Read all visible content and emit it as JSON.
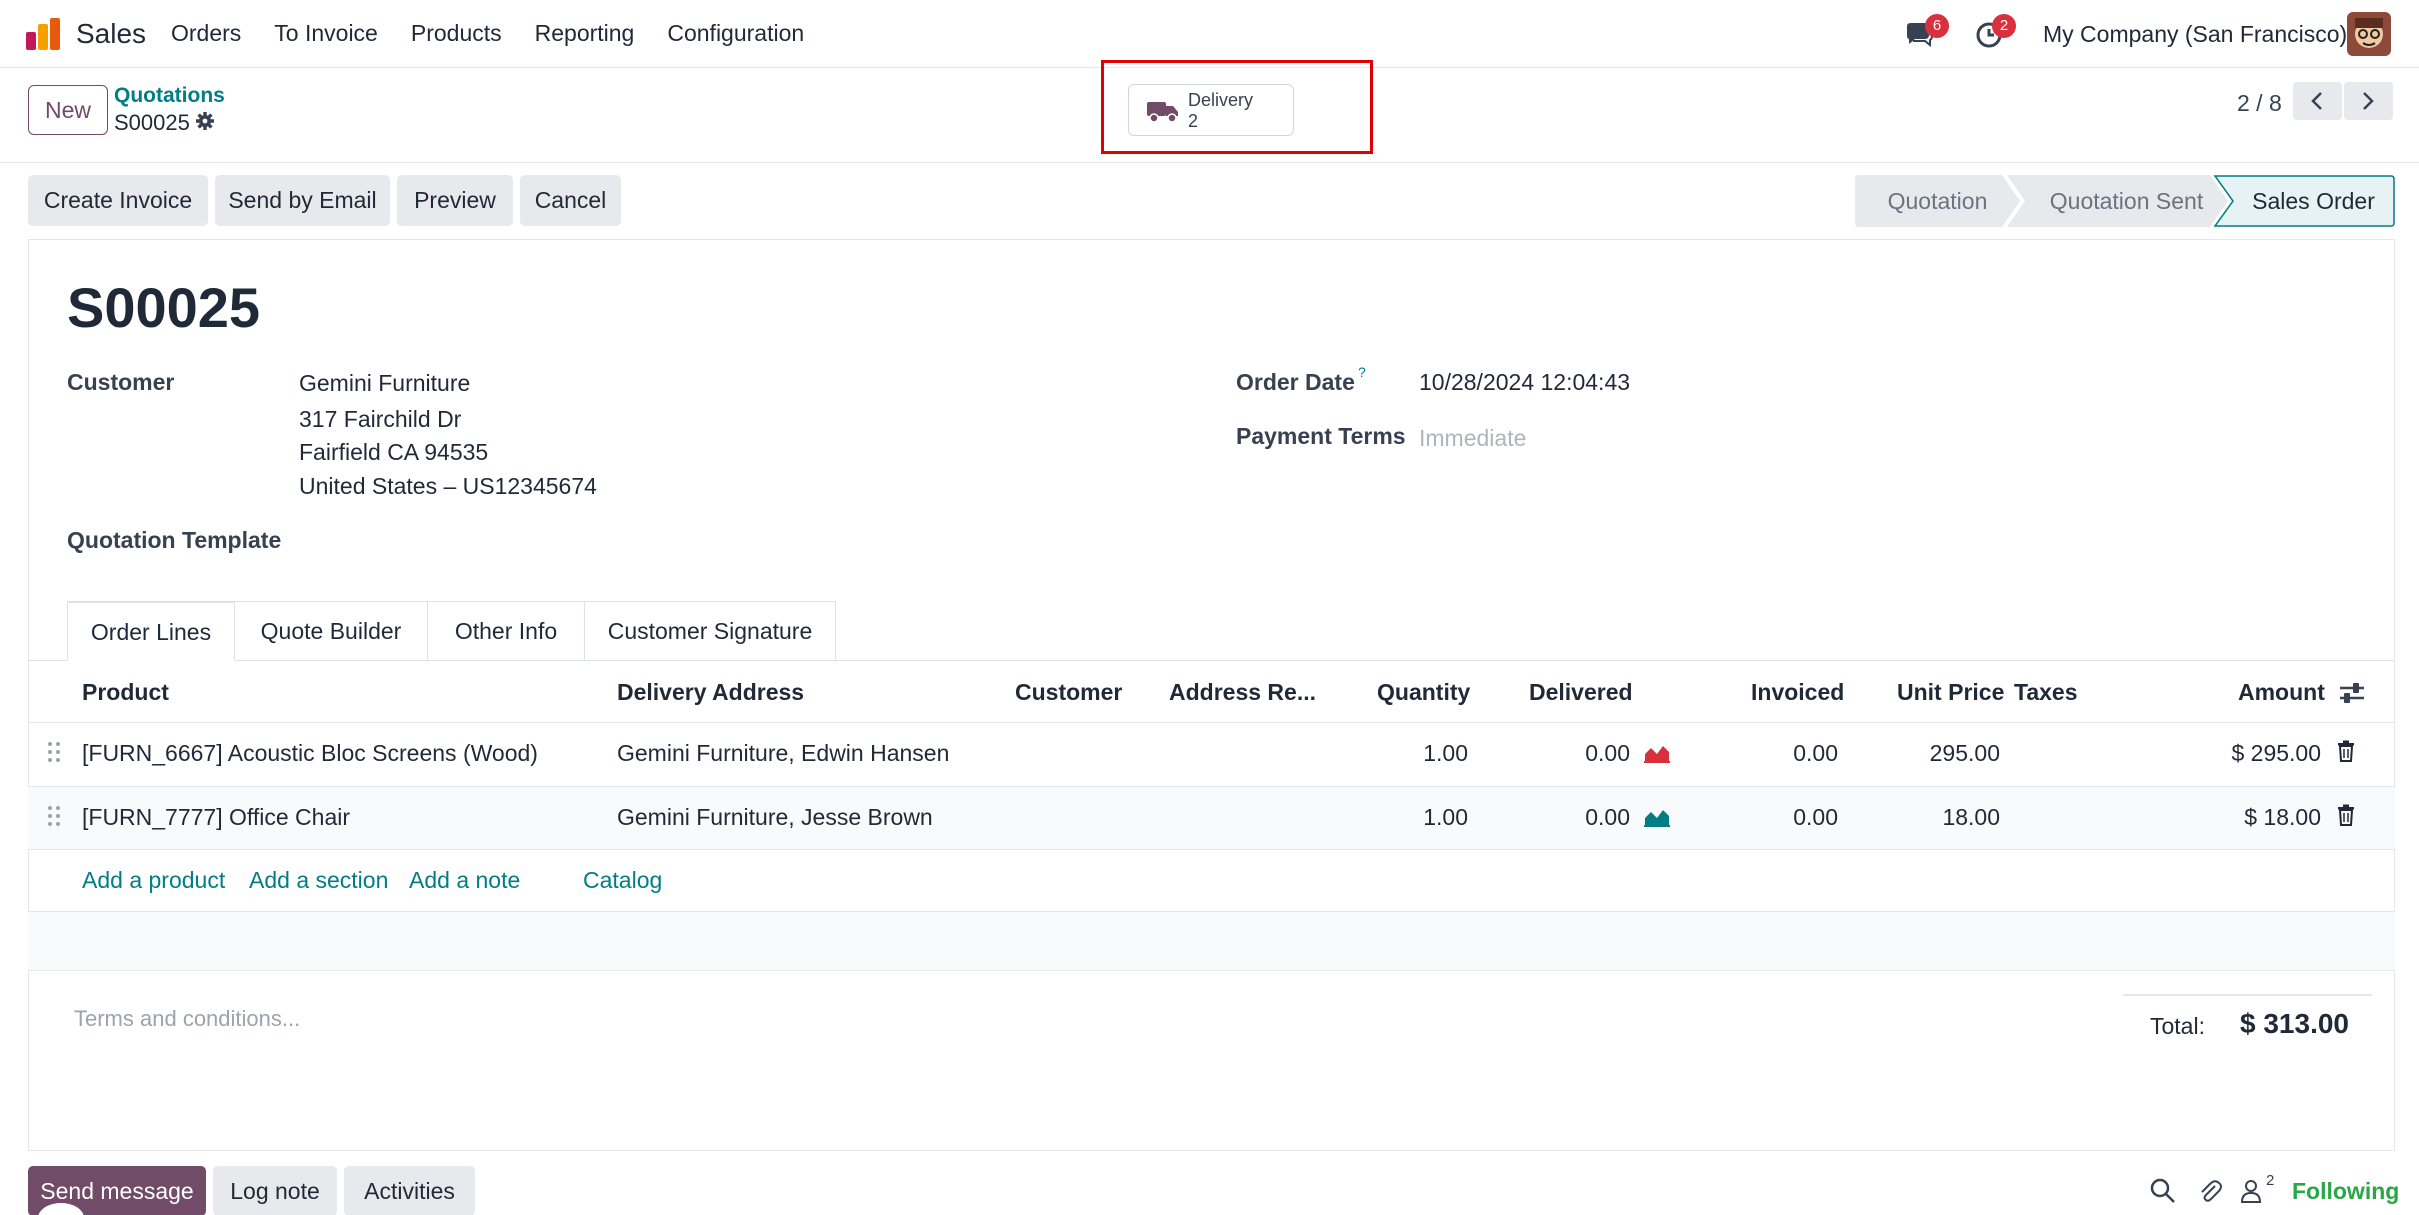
{
  "navbar": {
    "app_name": "Sales",
    "menu": [
      "Orders",
      "To Invoice",
      "Products",
      "Reporting",
      "Configuration"
    ],
    "messages_count": "6",
    "activities_count": "2",
    "company": "My Company (San Francisco)"
  },
  "control_panel": {
    "new_label": "New",
    "breadcrumb_parent": "Quotations",
    "breadcrumb_current": "S00025",
    "smart_button": {
      "label": "Delivery",
      "value": "2"
    },
    "pager": "2 / 8"
  },
  "actions": [
    "Create Invoice",
    "Send by Email",
    "Preview",
    "Cancel"
  ],
  "stages": [
    "Quotation",
    "Quotation Sent",
    "Sales Order"
  ],
  "active_stage": "Sales Order",
  "form": {
    "name": "S00025",
    "customer_label": "Customer",
    "customer_name": "Gemini Furniture",
    "customer_address": [
      "317 Fairchild Dr",
      "Fairfield CA 94535",
      "United States – US12345674"
    ],
    "template_label": "Quotation Template",
    "order_date_label": "Order Date",
    "order_date_help": "?",
    "order_date": "10/28/2024 12:04:43",
    "payment_terms_label": "Payment Terms",
    "payment_terms_placeholder": "Immediate"
  },
  "tabs": [
    "Order Lines",
    "Quote Builder",
    "Other Info",
    "Customer Signature"
  ],
  "table": {
    "columns": [
      "Product",
      "Delivery Address",
      "Customer",
      "Address Re...",
      "Quantity",
      "Delivered",
      "Invoiced",
      "Unit Price",
      "Taxes",
      "Amount"
    ],
    "rows": [
      {
        "product": "[FURN_6667] Acoustic Bloc Screens (Wood)",
        "delivery_address": "Gemini Furniture, Edwin Hansen",
        "quantity": "1.00",
        "delivered": "0.00",
        "invoiced": "0.00",
        "unit_price": "295.00",
        "amount": "$ 295.00",
        "forecast_color": "#d9303e"
      },
      {
        "product": "[FURN_7777] Office Chair",
        "delivery_address": "Gemini Furniture, Jesse Brown",
        "quantity": "1.00",
        "delivered": "0.00",
        "invoiced": "0.00",
        "unit_price": "18.00",
        "amount": "$ 18.00",
        "forecast_color": "#017e84"
      }
    ],
    "add_links": [
      "Add a product",
      "Add a section",
      "Add a note",
      "Catalog"
    ]
  },
  "footer": {
    "terms_placeholder": "Terms and conditions...",
    "total_label": "Total:",
    "total_value": "$ 313.00"
  },
  "chatter": {
    "send_message": "Send message",
    "log_note": "Log note",
    "activities": "Activities",
    "followers_count": "2",
    "following": "Following"
  },
  "colors": {
    "brand": "#714b67",
    "accent": "#017e84",
    "badge": "#d9303e",
    "following": "#28a745"
  }
}
